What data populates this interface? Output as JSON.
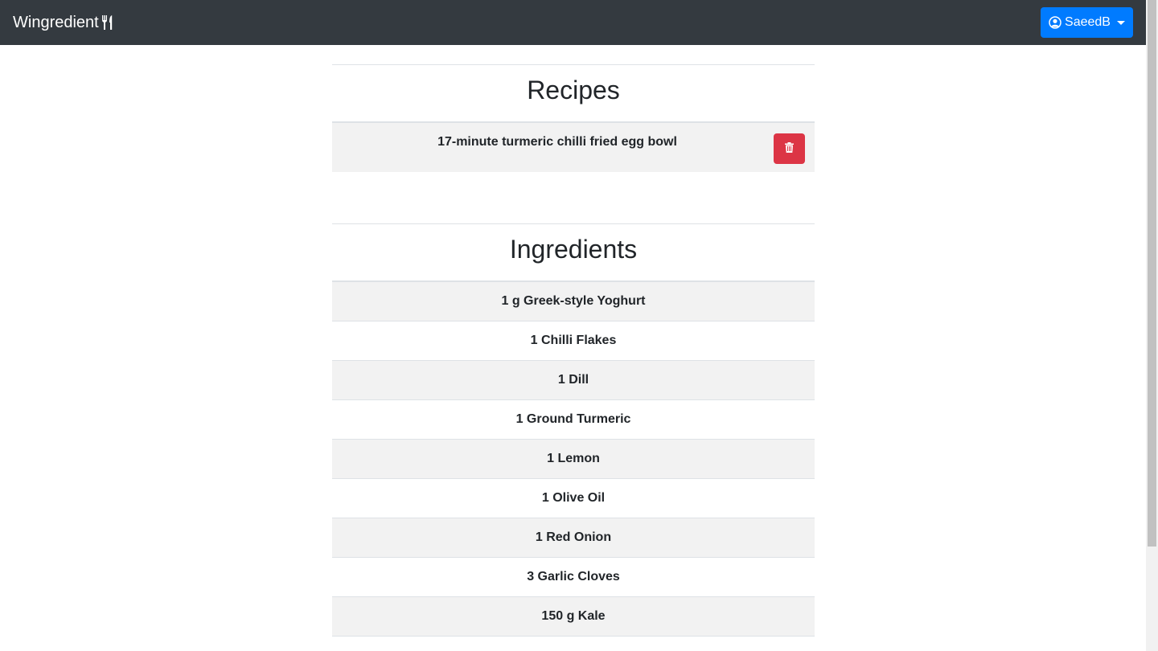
{
  "navbar": {
    "brand": "Wingredient",
    "brand_icon": "utensils-icon",
    "user": "SaeedB",
    "user_icon": "user-circle-icon"
  },
  "recipes": {
    "title": "Recipes",
    "items": [
      {
        "name": "17-minute turmeric chilli fried egg bowl",
        "delete_icon": "trash-icon"
      }
    ]
  },
  "ingredients": {
    "title": "Ingredients",
    "items": [
      "1 g Greek-style Yoghurt",
      "1 Chilli Flakes",
      "1 Dill",
      "1 Ground Turmeric",
      "1 Lemon",
      "1 Olive Oil",
      "1 Red Onion",
      "3 Garlic Cloves",
      "150 g Kale"
    ]
  },
  "colors": {
    "navbar_bg": "#343a40",
    "primary": "#007bff",
    "danger": "#dc3545",
    "stripe": "#f2f2f2"
  }
}
